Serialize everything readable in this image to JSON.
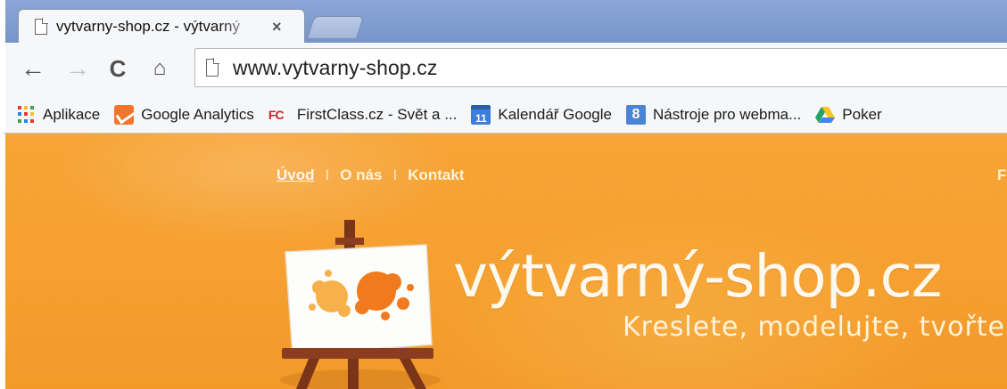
{
  "browser": {
    "tab": {
      "title": "vytvarny-shop.cz - výtvarný",
      "close": "×"
    },
    "toolbar": {
      "back": "←",
      "forward": "→",
      "reload": "C",
      "home": "⌂"
    },
    "omnibox": {
      "url": "www.vytvarny-shop.cz"
    },
    "bookmarks": [
      {
        "label": "Aplikace",
        "icon": "apps-grid-icon"
      },
      {
        "label": "Google Analytics",
        "icon": "google-analytics-icon"
      },
      {
        "label": "FirstClass.cz - Svět a ...",
        "icon": "firstclass-icon",
        "icon_text": "FC"
      },
      {
        "label": "Kalendář Google",
        "icon": "google-calendar-icon",
        "icon_text": "11"
      },
      {
        "label": "Nástroje pro webma...",
        "icon": "webmaster-tools-icon",
        "icon_text": "8"
      },
      {
        "label": "Poker",
        "icon": "google-drive-icon"
      }
    ]
  },
  "site": {
    "nav": [
      "Úvod",
      "I",
      "O nás",
      "I",
      "Kontakt"
    ],
    "nav_cut": "F",
    "brand": "výtvarný-shop.cz",
    "tagline": "Kreslete, modelujte, tvořte"
  },
  "colors": {
    "page_orange": "#f5a030",
    "tab_strip": "#7f9dcf",
    "easel_wood": "#8a3e1f",
    "splash_orange": "#f07a1c"
  }
}
